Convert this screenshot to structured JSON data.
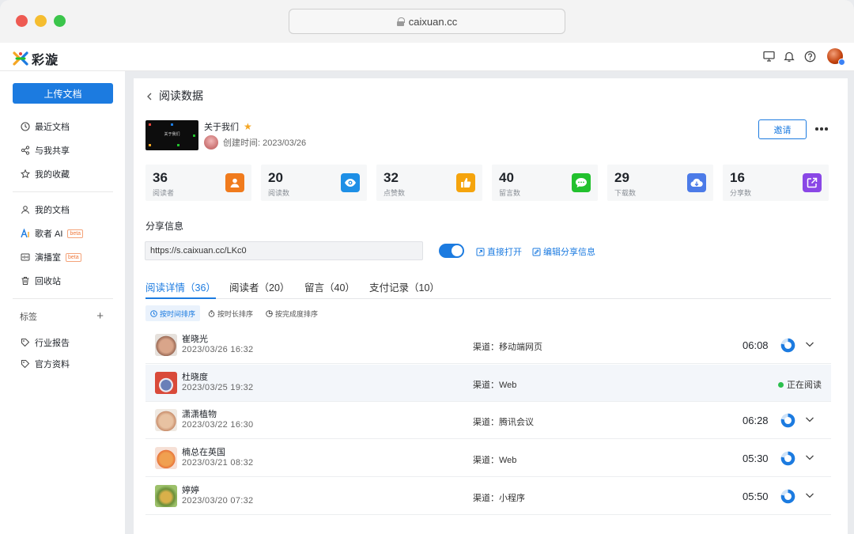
{
  "browser": {
    "url": "caixuan.cc"
  },
  "app": {
    "logo_text": "彩漩"
  },
  "sidebar": {
    "upload_label": "上传文档",
    "items": [
      {
        "label": "最近文档",
        "icon": "clock-icon"
      },
      {
        "label": "与我共享",
        "icon": "share-icon"
      },
      {
        "label": "我的收藏",
        "icon": "star-outline-icon"
      },
      {
        "label": "我的文档",
        "icon": "user-icon"
      },
      {
        "label": "歌者 AI",
        "icon": "ai-icon",
        "badge": "beta"
      },
      {
        "label": "演播室",
        "icon": "studio-icon",
        "badge": "beta"
      },
      {
        "label": "回收站",
        "icon": "trash-icon"
      }
    ],
    "tags_label": "标签",
    "tags": [
      {
        "label": "行业报告"
      },
      {
        "label": "官方资料"
      }
    ]
  },
  "page": {
    "title": "阅读数据",
    "doc": {
      "title": "关于我们",
      "thumb_text": "关于我们",
      "created": "创建时间: 2023/03/26"
    },
    "invite_label": "邀请",
    "stats": [
      {
        "value": "36",
        "label": "阅读者",
        "color": "#f07b1d"
      },
      {
        "value": "20",
        "label": "阅读数",
        "color": "#1e8fe6"
      },
      {
        "value": "32",
        "label": "点赞数",
        "color": "#f5a40d"
      },
      {
        "value": "40",
        "label": "留言数",
        "color": "#22c12e"
      },
      {
        "value": "29",
        "label": "下载数",
        "color": "#4c7be8"
      },
      {
        "value": "16",
        "label": "分享数",
        "color": "#8a47e6"
      }
    ],
    "share": {
      "title": "分享信息",
      "url": "https://s.caixuan.cc/LKc0",
      "toggle_on": true,
      "open_label": "直接打开",
      "edit_label": "编辑分享信息"
    },
    "tabs": [
      {
        "label": "阅读详情（36）",
        "active": true
      },
      {
        "label": "阅读者（20）"
      },
      {
        "label": "留言（40）"
      },
      {
        "label": "支付记录（10）"
      }
    ],
    "sorts": [
      {
        "label": "按时间排序",
        "active": true
      },
      {
        "label": "按时长排序"
      },
      {
        "label": "按完成度排序"
      }
    ],
    "rows": [
      {
        "name": "崔晓光",
        "time": "2023/03/26   16:32",
        "channel": "渠道：移动端网页",
        "duration": "06:08",
        "progress": 0.78
      },
      {
        "name": "杜晓度",
        "time": "2023/03/25   19:32",
        "channel": "渠道：Web",
        "status": "正在阅读"
      },
      {
        "name": "潇潇植物",
        "time": "2023/03/22   16:30",
        "channel": "渠道：腾讯会议",
        "duration": "06:28",
        "progress": 0.78
      },
      {
        "name": "楠总在英国",
        "time": "2023/03/21   08:32",
        "channel": "渠道：Web",
        "duration": "05:30",
        "progress": 0.78
      },
      {
        "name": "婷婷",
        "time": "2023/03/20    07:32",
        "channel": "渠道：小程序",
        "duration": "05:50",
        "progress": 0.78
      }
    ]
  }
}
